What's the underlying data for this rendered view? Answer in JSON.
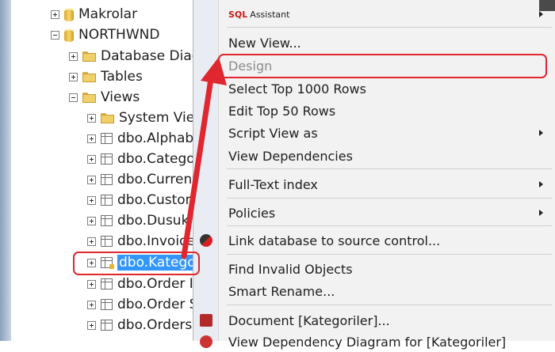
{
  "tree": {
    "nodes": [
      {
        "label": "Makrolar",
        "icon": "database-icon",
        "expander": "plus"
      },
      {
        "label": "NORTHWND",
        "icon": "database-icon",
        "expander": "minus"
      },
      {
        "label": "Database Diag",
        "icon": "folder-icon",
        "expander": "plus"
      },
      {
        "label": "Tables",
        "icon": "folder-icon",
        "expander": "plus"
      },
      {
        "label": "Views",
        "icon": "folder-icon",
        "expander": "minus"
      },
      {
        "label": "System View",
        "icon": "folder-icon",
        "expander": "plus"
      },
      {
        "label": "dbo.Alphab",
        "icon": "view-icon",
        "expander": "plus"
      },
      {
        "label": "dbo.Catego",
        "icon": "view-icon",
        "expander": "plus"
      },
      {
        "label": "dbo.Current",
        "icon": "view-icon",
        "expander": "plus"
      },
      {
        "label": "dbo.Custon",
        "icon": "view-icon",
        "expander": "plus"
      },
      {
        "label": "dbo.Dusuk",
        "icon": "view-icon",
        "expander": "plus"
      },
      {
        "label": "dbo.Invoice",
        "icon": "view-icon",
        "expander": "plus"
      },
      {
        "label": "dbo.Katego",
        "icon": "view-icon",
        "expander": "plus",
        "selected": true
      },
      {
        "label": "dbo.Order I",
        "icon": "view-icon",
        "expander": "plus"
      },
      {
        "label": "dbo.Order S",
        "icon": "view-icon",
        "expander": "plus"
      },
      {
        "label": "dbo.Orders",
        "icon": "view-icon",
        "expander": "plus"
      }
    ]
  },
  "menu": {
    "sql_assistant": {
      "brand": "SQL",
      "label": "Assistant"
    },
    "items": [
      {
        "label": "New View..."
      },
      {
        "label": "Design",
        "disabled": true
      },
      {
        "label": "Select Top 1000 Rows"
      },
      {
        "label": "Edit Top 50 Rows"
      },
      {
        "label": "Script View as",
        "submenu": true
      },
      {
        "label": "View Dependencies"
      },
      {
        "label": "Full-Text index",
        "submenu": true
      },
      {
        "label": "Policies",
        "submenu": true
      },
      {
        "label": "Link database to source control..."
      },
      {
        "label": "Find Invalid Objects"
      },
      {
        "label": "Smart Rename..."
      },
      {
        "label": "Document [Kategoriler]..."
      },
      {
        "label": "View Dependency Diagram for [Kategoriler]"
      }
    ]
  },
  "annotation": {
    "color": "#e0272f"
  },
  "colors": {
    "selection": "#3296ff",
    "menu_background": "#f2f2f2"
  }
}
